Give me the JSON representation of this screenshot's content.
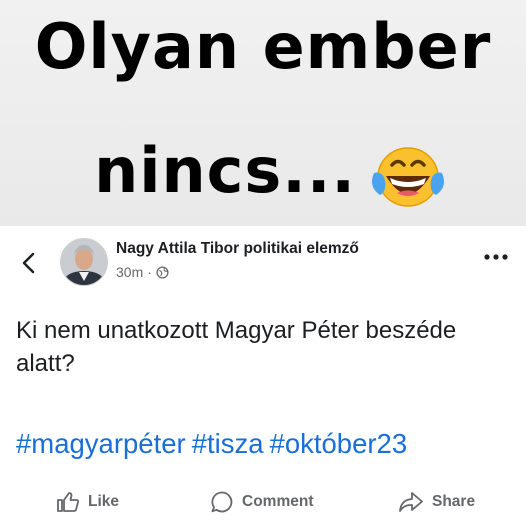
{
  "meme": {
    "line1": "Olyan ember",
    "line2": "nincs...",
    "emoji": "face-with-tears-of-joy-emoji"
  },
  "post": {
    "author": "Nagy Attila Tibor politikai elemző",
    "time": "30m",
    "separator": "·",
    "privacy_icon": "globe-icon",
    "text": "Ki nem unatkozott Magyar Péter beszéde alatt?",
    "hashtags": [
      "#magyarpéter",
      "#tisza",
      "#október23"
    ]
  },
  "actions": {
    "like": "Like",
    "comment": "Comment",
    "share": "Share"
  },
  "colors": {
    "hashtag": "#1a6ed8",
    "muted": "#65676b",
    "text": "#1c1e21"
  }
}
